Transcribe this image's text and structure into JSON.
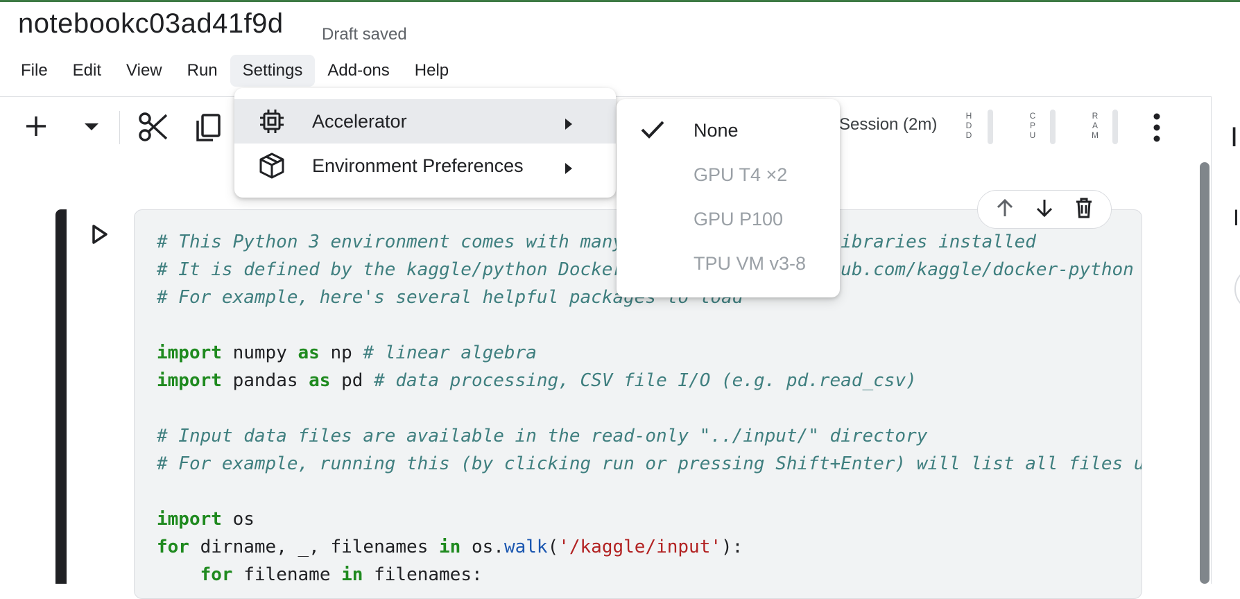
{
  "header": {
    "title": "notebookc03ad41f9d",
    "status": "Draft saved"
  },
  "menubar": [
    "File",
    "Edit",
    "View",
    "Run",
    "Settings",
    "Add-ons",
    "Help"
  ],
  "toolbar": {
    "session": "Session (2m)",
    "meters": [
      "H\nD\nD",
      "C\nP\nU",
      "R\nA\nM"
    ]
  },
  "settings_menu": {
    "items": [
      {
        "label": "Accelerator",
        "icon": "chip-icon"
      },
      {
        "label": "Environment Preferences",
        "icon": "package-icon"
      }
    ]
  },
  "accelerator_submenu": {
    "selected": "None",
    "items": [
      "None",
      "GPU T4 ×2",
      "GPU P100",
      "TPU VM v3-8"
    ]
  },
  "code": {
    "lines": [
      "# This Python 3 environment comes with many helpful analytics libraries installed",
      "# It is defined by the kaggle/python Docker image: https://github.com/kaggle/docker-python",
      "# For example, here's several helpful packages to load",
      "",
      "import numpy as np # linear algebra",
      "import pandas as pd # data processing, CSV file I/O (e.g. pd.read_csv)",
      "",
      "# Input data files are available in the read-only \"../input/\" directory",
      "# For example, running this (by clicking run or pressing Shift+Enter) will list all files under the input directory",
      "",
      "import os",
      "for dirname, _, filenames in os.walk('/kaggle/input'):",
      "    for filename in filenames:"
    ]
  },
  "right_panel": {
    "chars": [
      "I",
      "I"
    ]
  }
}
